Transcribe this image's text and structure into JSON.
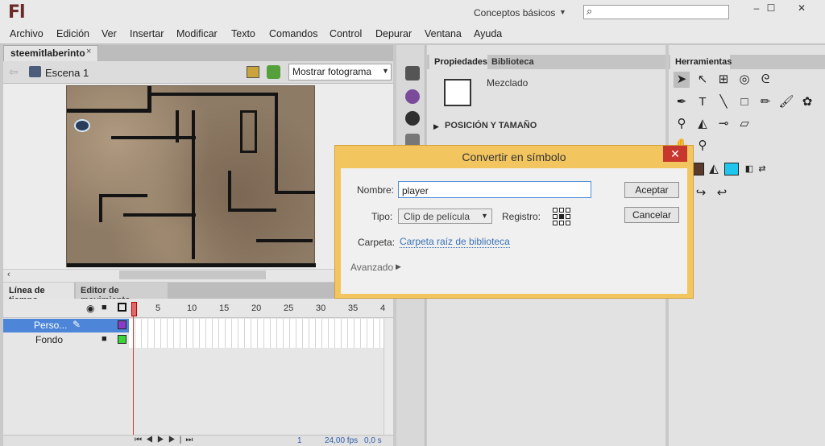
{
  "app": {
    "logo": "Fl",
    "workspace": "Conceptos básicos",
    "window_buttons": [
      "–",
      "☐",
      "✕"
    ]
  },
  "menu": [
    "Archivo",
    "Edición",
    "Ver",
    "Insertar",
    "Modificar",
    "Texto",
    "Comandos",
    "Control",
    "Depurar",
    "Ventana",
    "Ayuda"
  ],
  "document": {
    "tab": "steemitlaberinto",
    "tab_close": "×",
    "scene": "Escena 1",
    "zoom": "Mostrar fotograma"
  },
  "timeline": {
    "tabs": [
      "Línea de tiempo",
      "Editor de movimiento"
    ],
    "frame_numbers": [
      "1",
      "5",
      "10",
      "15",
      "20",
      "25",
      "30",
      "35",
      "4"
    ],
    "layers": [
      {
        "name": "Perso..."
      },
      {
        "name": "Fondo"
      }
    ],
    "footer": {
      "frame": "1",
      "fps": "24,00 fps",
      "time": "0,0 s"
    }
  },
  "properties": {
    "tabs": [
      "Propiedades",
      "Biblioteca"
    ],
    "blend": "Mezclado",
    "section": "POSICIÓN Y TAMAÑO"
  },
  "tools": {
    "title": "Herramientas"
  },
  "dialog": {
    "title": "Convertir en símbolo",
    "close": "✕",
    "name_label": "Nombre:",
    "name_value": "player",
    "type_label": "Tipo:",
    "type_value": "Clip de película",
    "registration_label": "Registro:",
    "folder_label": "Carpeta:",
    "folder_value": "Carpeta raíz de biblioteca",
    "advanced_label": "Avanzado",
    "ok_button": "Aceptar",
    "cancel_button": "Cancelar"
  },
  "colors": {
    "dialog_frame": "#f2c55f",
    "close_red": "#c8372d",
    "layer_selected": "#4d86d8",
    "fill_color": "#1ec6ee",
    "stroke_color": "#5a3a2a"
  }
}
